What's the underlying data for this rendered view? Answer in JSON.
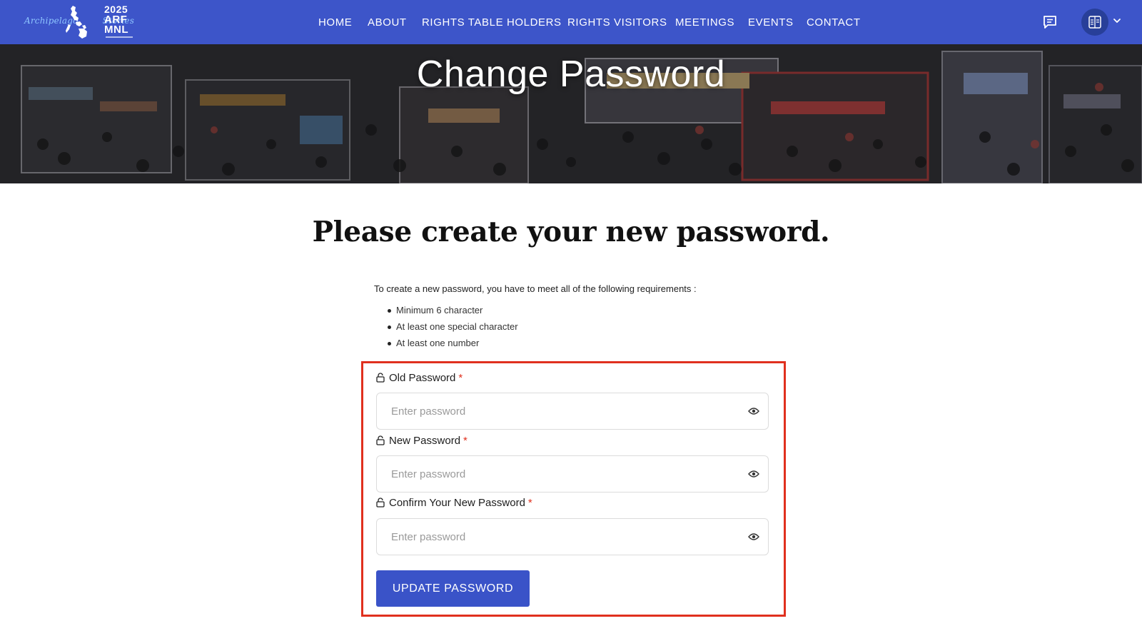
{
  "brand": {
    "script_left": "Archipelago",
    "script_right": "Stories",
    "year": "2025",
    "abbr_line1": "ARF",
    "abbr_line2": "MNL"
  },
  "nav": {
    "items": [
      {
        "label": "HOME"
      },
      {
        "label": "ABOUT"
      },
      {
        "label": "RIGHTS TABLE HOLDERS"
      },
      {
        "label": "RIGHTS VISITORS"
      },
      {
        "label": "MEETINGS"
      },
      {
        "label": "EVENTS"
      },
      {
        "label": "CONTACT"
      }
    ],
    "icons": {
      "messages": "message-icon",
      "profile": "book-grid-icon",
      "dropdown": "chevron-down-icon"
    }
  },
  "hero": {
    "title": "Change Password"
  },
  "main": {
    "heading": "Please create your new password.",
    "requirements_intro": "To create a new password, you have to meet all of the following requirements :",
    "requirements": [
      "Minimum 6 character",
      "At least one special character",
      "At least one number"
    ]
  },
  "form": {
    "fields": [
      {
        "label": "Old Password",
        "required_mark": "*",
        "placeholder": "Enter password",
        "value": ""
      },
      {
        "label": "New Password",
        "required_mark": "*",
        "placeholder": "Enter password",
        "value": ""
      },
      {
        "label": "Confirm Your New Password",
        "required_mark": "*",
        "placeholder": "Enter password",
        "value": ""
      }
    ],
    "submit_label": "UPDATE PASSWORD"
  },
  "colors": {
    "nav_bg": "#3d55c9",
    "button_bg": "#3a53c8",
    "highlight_border": "#e0301e",
    "required_mark": "#e0301e"
  }
}
